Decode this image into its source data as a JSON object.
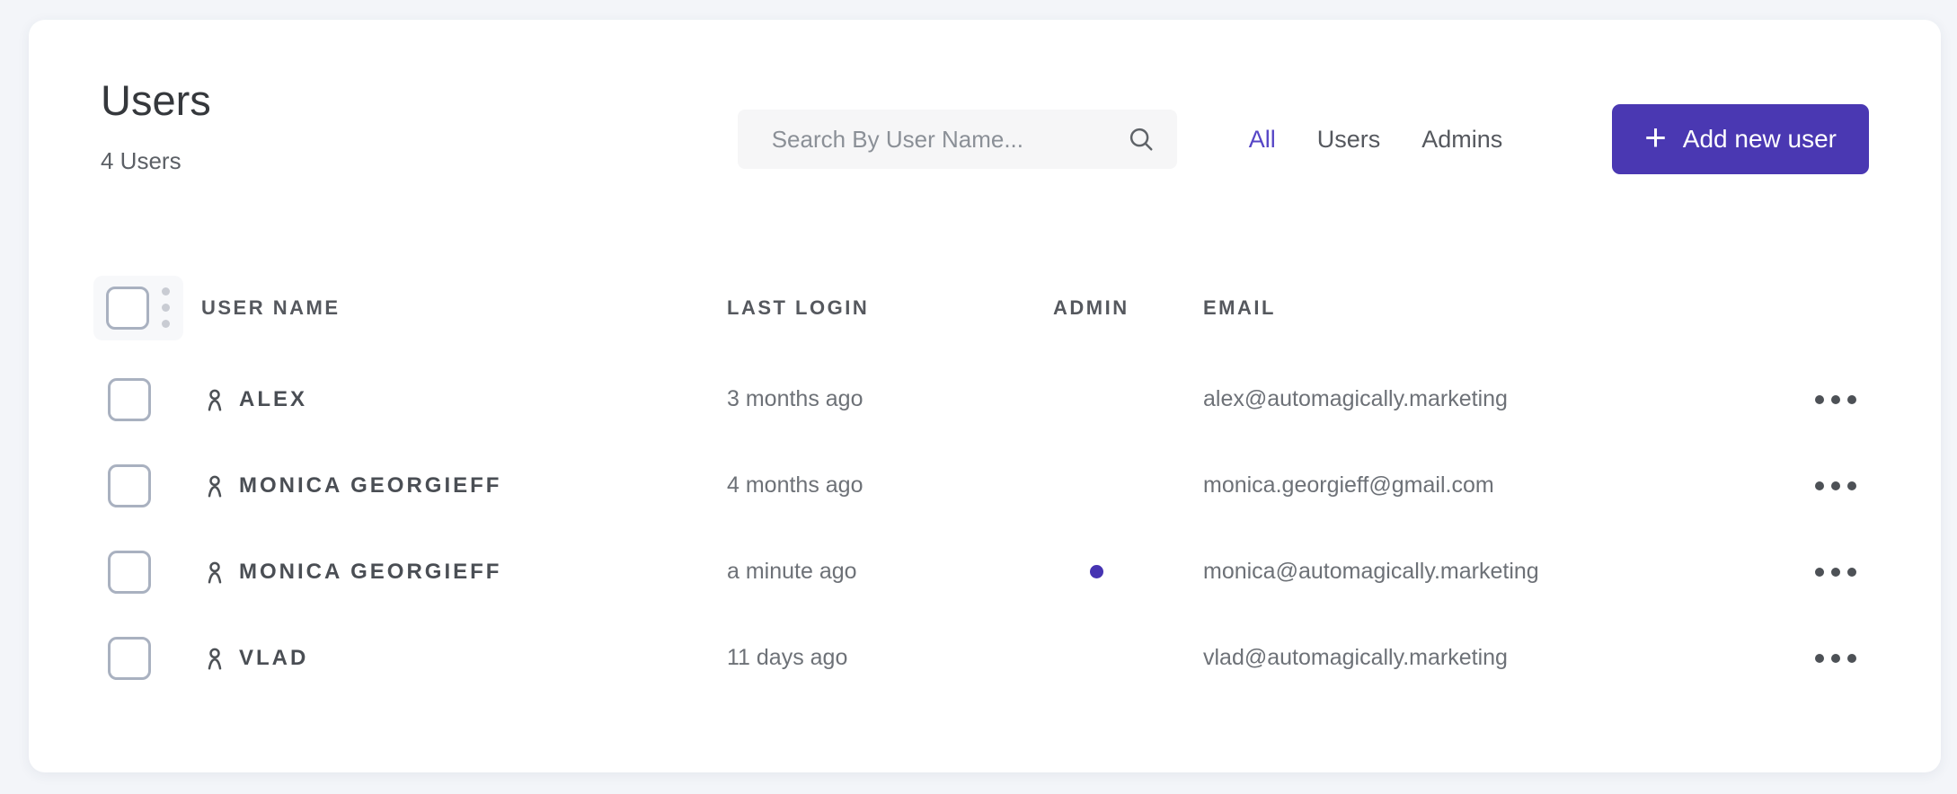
{
  "colors": {
    "page_background": "#f3f5f9",
    "card_background": "#ffffff",
    "accent": "#4a38b2",
    "active_tab": "#5646c6",
    "admin_dot": "#4634b2"
  },
  "header": {
    "title": "Users",
    "subtitle": "4 Users",
    "search": {
      "placeholder": "Search By User Name..."
    },
    "filters": [
      {
        "label": "All",
        "active": true
      },
      {
        "label": "Users",
        "active": false
      },
      {
        "label": "Admins",
        "active": false
      }
    ],
    "add_button": {
      "label": "Add new user",
      "plus": "+"
    }
  },
  "table": {
    "columns": [
      "USER NAME",
      "LAST LOGIN",
      "ADMIN",
      "EMAIL"
    ],
    "rows": [
      {
        "name": "ALEX",
        "last_login": "3 months ago",
        "admin": false,
        "email": "alex@automagically.marketing"
      },
      {
        "name": "MONICA GEORGIEFF",
        "last_login": "4 months ago",
        "admin": false,
        "email": "monica.georgieff@gmail.com"
      },
      {
        "name": "MONICA GEORGIEFF",
        "last_login": "a minute ago",
        "admin": true,
        "email": "monica@automagically.marketing"
      },
      {
        "name": "VLAD",
        "last_login": "11 days ago",
        "admin": false,
        "email": "vlad@automagically.marketing"
      }
    ]
  }
}
